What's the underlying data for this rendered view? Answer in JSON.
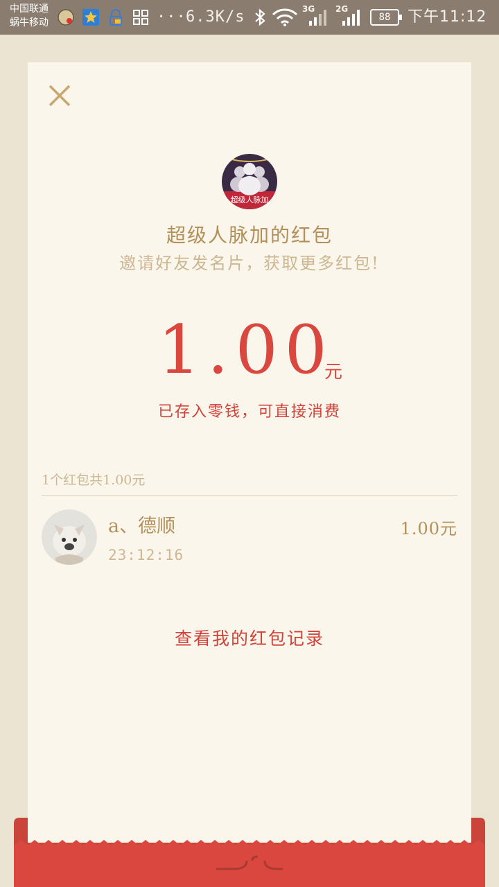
{
  "status_bar": {
    "carrier_1": "中国联通",
    "carrier_2": "蜗牛移动",
    "more": "···",
    "speed": "6.3K/s",
    "network_1": "3G",
    "network_2": "2G",
    "battery": "88",
    "time": "下午11:12"
  },
  "card": {
    "sender_title": "超级人脉加的红包",
    "logo_text": "超级人脉加",
    "subtitle": "邀请好友发名片，获取更多红包!",
    "amount": "1.00",
    "amount_unit": "元",
    "stored_note": "已存入零钱，可直接消费",
    "summary": "1个红包共1.00元",
    "records": [
      {
        "name": "a、德顺",
        "time": "23:12:16",
        "amount": "1.00元"
      }
    ],
    "history_link": "查看我的红包记录"
  },
  "colors": {
    "status_bar": "#8a7d6f",
    "background": "#ece4d3",
    "card": "#faf6ec",
    "accent_red": "#d9473e",
    "gold_text": "#b39059",
    "light_gold_text": "#cdb792"
  },
  "icons": [
    "close-icon",
    "wifi-icon",
    "bluetooth-icon",
    "battery-icon",
    "grid-icon"
  ]
}
